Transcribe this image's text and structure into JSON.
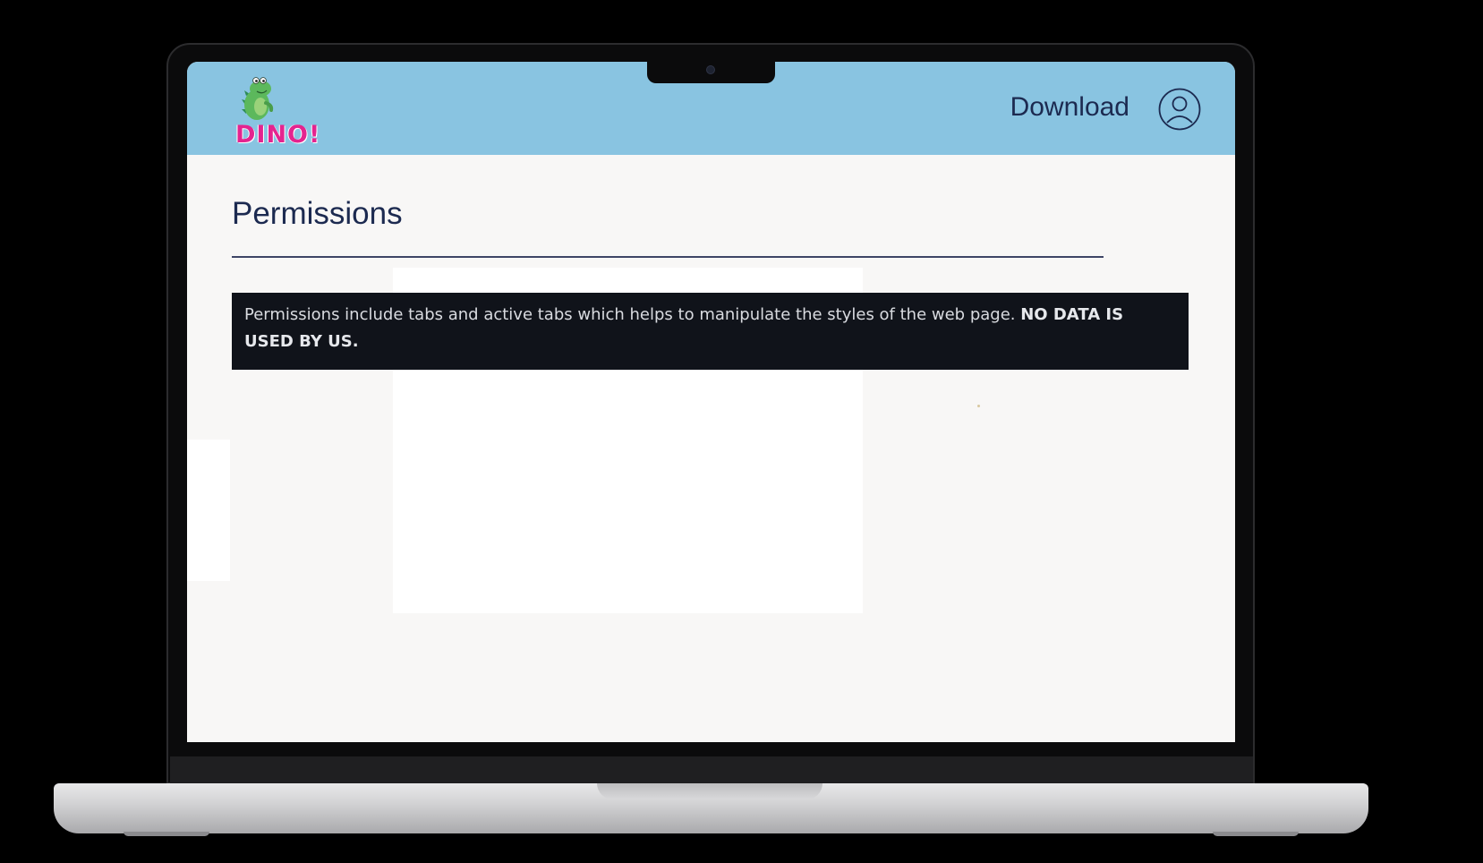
{
  "header": {
    "logo_text": "DINO!",
    "download_label": "Download",
    "user_icon": "user-circle-icon",
    "background_color": "#89c4e1"
  },
  "main": {
    "title": "Permissions",
    "notice": {
      "text": "Permissions include tabs and active tabs which helps to manipulate the styles of the web page. ",
      "emphasis": "NO DATA IS USED BY US."
    }
  },
  "colors": {
    "accent_pink": "#e4248f",
    "text_navy": "#1c2a50",
    "notice_bg": "#10131a"
  }
}
